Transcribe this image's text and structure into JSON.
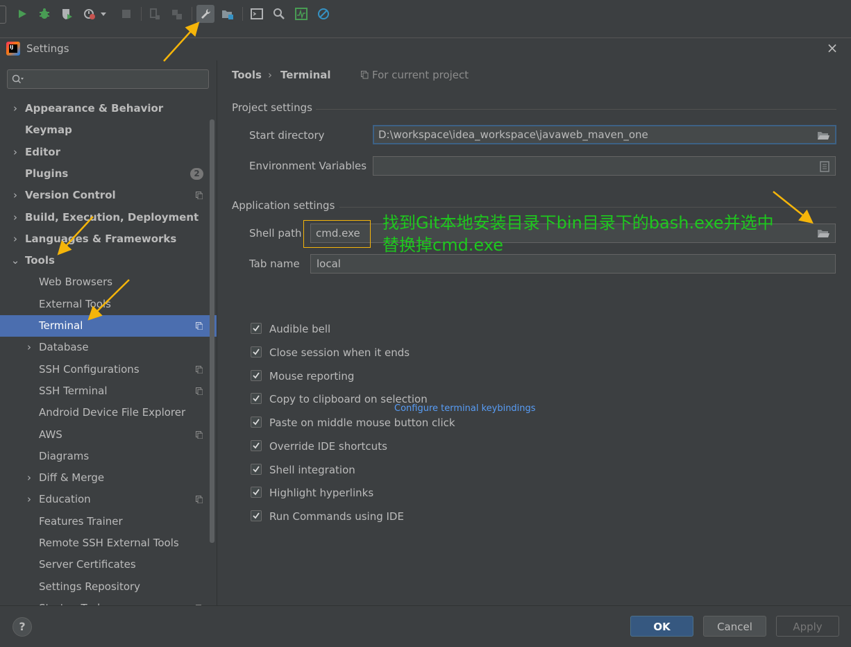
{
  "dialog": {
    "title": "Settings",
    "close_glyph": "×",
    "logo_text": "IJ"
  },
  "search": {
    "placeholder": "",
    "icon": "search-icon"
  },
  "sidebar": {
    "items": [
      {
        "label": "Appearance & Behavior",
        "bold": true,
        "chevron": "›",
        "level": 0
      },
      {
        "label": "Keymap",
        "bold": true,
        "level": 0
      },
      {
        "label": "Editor",
        "bold": true,
        "chevron": "›",
        "level": 0
      },
      {
        "label": "Plugins",
        "bold": true,
        "level": 0,
        "badge": "2"
      },
      {
        "label": "Version Control",
        "bold": true,
        "chevron": "›",
        "level": 0,
        "project": true
      },
      {
        "label": "Build, Execution, Deployment",
        "bold": true,
        "chevron": "›",
        "level": 0
      },
      {
        "label": "Languages & Frameworks",
        "bold": true,
        "chevron": "›",
        "level": 0
      },
      {
        "label": "Tools",
        "bold": true,
        "chevron": "⌄",
        "level": 0,
        "expanded": true
      },
      {
        "label": "Web Browsers",
        "level": 1
      },
      {
        "label": "External Tools",
        "level": 1
      },
      {
        "label": "Terminal",
        "level": 1,
        "selected": true,
        "project": true
      },
      {
        "label": "Database",
        "level": 1,
        "chevron": "›"
      },
      {
        "label": "SSH Configurations",
        "level": 1,
        "project": true
      },
      {
        "label": "SSH Terminal",
        "level": 1,
        "project": true
      },
      {
        "label": "Android Device File Explorer",
        "level": 1
      },
      {
        "label": "AWS",
        "level": 1,
        "project": true
      },
      {
        "label": "Diagrams",
        "level": 1
      },
      {
        "label": "Diff & Merge",
        "level": 1,
        "chevron": "›"
      },
      {
        "label": "Education",
        "level": 1,
        "chevron": "›",
        "project": true
      },
      {
        "label": "Features Trainer",
        "level": 1
      },
      {
        "label": "Remote SSH External Tools",
        "level": 1
      },
      {
        "label": "Server Certificates",
        "level": 1
      },
      {
        "label": "Settings Repository",
        "level": 1
      },
      {
        "label": "Startup Tasks",
        "level": 1,
        "project": true
      }
    ]
  },
  "breadcrumb": {
    "parent": "Tools",
    "separator": "›",
    "current": "Terminal",
    "scope": "For current project"
  },
  "project_settings": {
    "title": "Project settings",
    "start_directory_label": "Start directory",
    "start_directory_value": "D:\\workspace\\idea_workspace\\javaweb_maven_one",
    "env_vars_label": "Environment Variables",
    "env_vars_value": ""
  },
  "application_settings": {
    "title": "Application settings",
    "shell_path_label": "Shell path",
    "shell_path_value": "cmd.exe",
    "tab_name_label": "Tab name",
    "tab_name_value": "local"
  },
  "checkboxes": [
    {
      "label": "Audible bell",
      "checked": true
    },
    {
      "label": "Close session when it ends",
      "checked": true
    },
    {
      "label": "Mouse reporting",
      "checked": true
    },
    {
      "label": "Copy to clipboard on selection",
      "checked": true
    },
    {
      "label": "Paste on middle mouse button click",
      "checked": true
    },
    {
      "label": "Override IDE shortcuts",
      "checked": true
    },
    {
      "label": "Shell integration",
      "checked": true
    },
    {
      "label": "Highlight hyperlinks",
      "checked": true
    },
    {
      "label": "Run Commands using IDE",
      "checked": true
    }
  ],
  "configure_link": "Configure terminal keybindings",
  "annotation": {
    "line1": "找到Git本地安装目录下bin目录下的bash.exe并选中",
    "line2": "替换掉cmd.exe",
    "color": "#1ec81e"
  },
  "footer": {
    "help": "?",
    "ok": "OK",
    "cancel": "Cancel",
    "apply": "Apply"
  },
  "colors": {
    "selection": "#4b6eaf",
    "accent_arrow": "#f5b50a",
    "link": "#589df6",
    "ok_button": "#365880"
  }
}
